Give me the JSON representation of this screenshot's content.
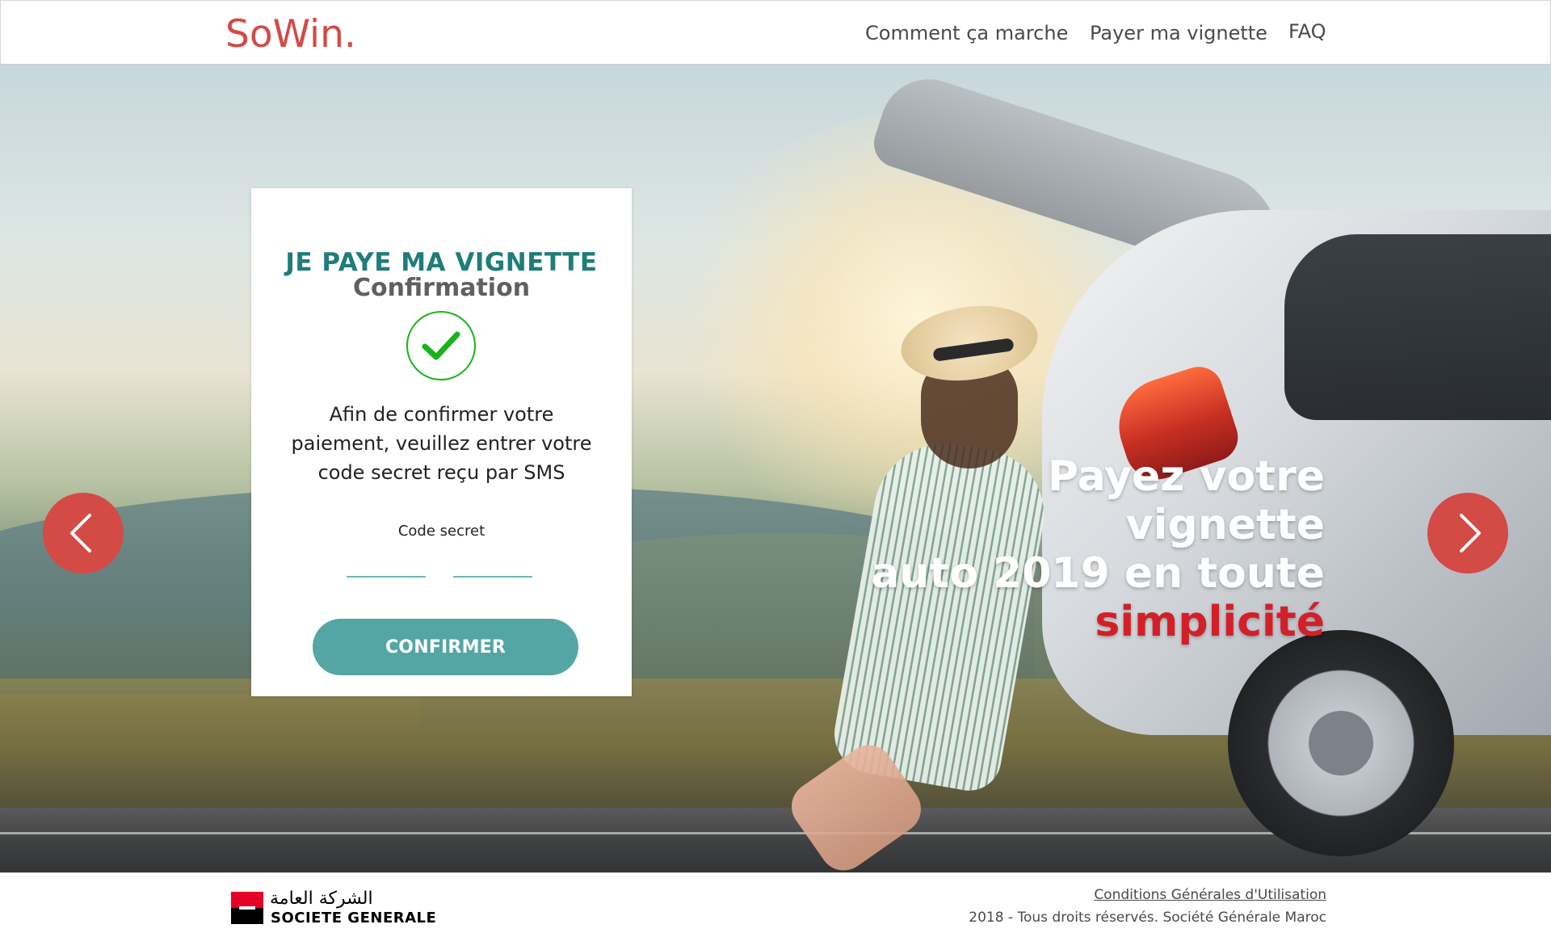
{
  "header": {
    "logo": "SoWin.",
    "nav": [
      {
        "label": "Comment ça marche"
      },
      {
        "label": "Payer ma vignette"
      },
      {
        "label": "FAQ"
      }
    ]
  },
  "hero": {
    "headline_line1": "Payez votre vignette",
    "headline_line2": "auto 2019 en toute",
    "headline_accent": "simplicité",
    "arrows": {
      "prev_icon": "chevron-left-icon",
      "next_icon": "chevron-right-icon"
    }
  },
  "card": {
    "title": "JE PAYE MA VIGNETTE",
    "subtitle": "Confirmation",
    "status_icon": "check-circle-icon",
    "message": "Afin de confirmer votre paiement, veuillez entrer votre code secret reçu par SMS",
    "code_label": "Code secret",
    "code_inputs": [
      {
        "value": "",
        "placeholder": ""
      },
      {
        "value": "",
        "placeholder": ""
      }
    ],
    "confirm_button": "CONFIRMER"
  },
  "footer": {
    "logo_ar": "الشركة العامة",
    "logo_en": "SOCIETE GENERALE",
    "terms_link": "Conditions Générales d'Utilisation",
    "copyright": "2018 - Tous droits réservés. Société Générale Maroc"
  },
  "colors": {
    "brand_red": "#d44a45",
    "teal": "#1f7d7a",
    "button_teal": "#54a6a4",
    "check_green": "#19b21d",
    "accent_red": "#d32028"
  }
}
